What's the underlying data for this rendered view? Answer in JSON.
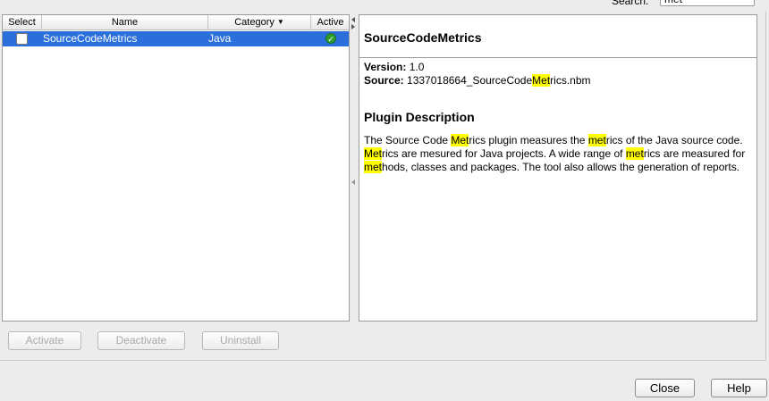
{
  "search": {
    "label": "Search:",
    "value": "met"
  },
  "table": {
    "headers": {
      "select": "Select",
      "name": "Name",
      "category": "Category",
      "active": "Active"
    },
    "rows": [
      {
        "name": "SourceCodeMetrics",
        "category": "Java",
        "selected": false,
        "active": true
      }
    ]
  },
  "detail": {
    "title": "SourceCodeMetrics",
    "version_label": "Version:",
    "version_value": "1.0",
    "source_label": "Source:",
    "source_prefix": "1337018664_SourceCode",
    "source_hl": "Met",
    "source_suffix": "rics.nbm",
    "description_heading": "Plugin Description",
    "description_parts": [
      {
        "t": "The Source Code ",
        "h": false
      },
      {
        "t": "Met",
        "h": true
      },
      {
        "t": "rics plugin measures the ",
        "h": false
      },
      {
        "t": "met",
        "h": true
      },
      {
        "t": "rics of the Java source code. ",
        "h": false
      },
      {
        "t": "Met",
        "h": true
      },
      {
        "t": "rics are mesured for Java projects. A wide range of ",
        "h": false
      },
      {
        "t": "met",
        "h": true
      },
      {
        "t": "rics are measured for ",
        "h": false
      },
      {
        "t": "met",
        "h": true
      },
      {
        "t": "hods, classes and packages. The tool also allows the generation of reports.",
        "h": false
      }
    ]
  },
  "buttons": {
    "activate": "Activate",
    "deactivate": "Deactivate",
    "uninstall": "Uninstall",
    "close": "Close",
    "help": "Help"
  },
  "colors": {
    "selection": "#2a6fdc",
    "highlight": "#ffff00",
    "active_ok": "#2e9e2e"
  },
  "icons": {
    "sort": "sort-descending-icon",
    "active": "checkmark-circle-icon"
  }
}
